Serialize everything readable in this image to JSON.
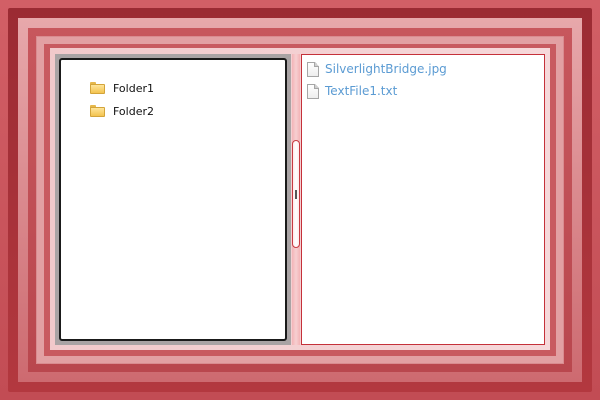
{
  "tree": {
    "folders": [
      {
        "label": "Folder1",
        "icon": "folder-icon"
      },
      {
        "label": "Folder2",
        "icon": "folder-icon"
      }
    ]
  },
  "files": {
    "items": [
      {
        "label": "SilverlightBridge.jpg",
        "icon": "file-icon"
      },
      {
        "label": "TextFile1.txt",
        "icon": "file-icon"
      }
    ]
  },
  "colors": {
    "frame": "#cc5a60",
    "file_link": "#5b9bd3",
    "pane_border": "#c5313a"
  }
}
